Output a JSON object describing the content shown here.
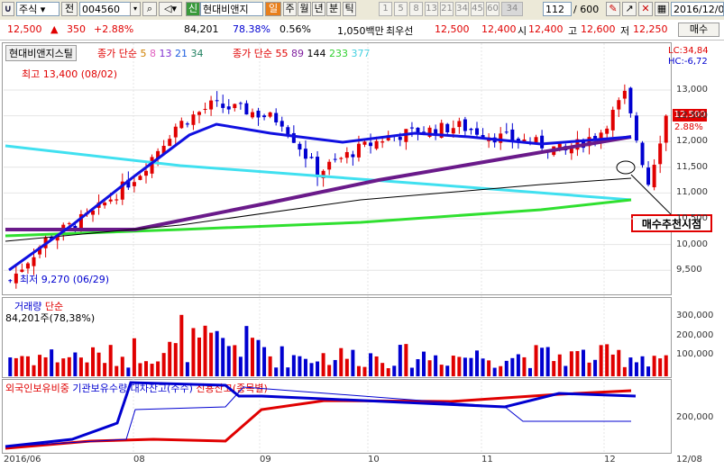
{
  "toolbar": {
    "market_type": "주식",
    "jeon_label": "전",
    "code": "004560",
    "sin_label": "신",
    "stock_name": "현대비앤지",
    "il_label": "일",
    "periods": [
      "주",
      "월",
      "년",
      "분",
      "틱"
    ],
    "minute_numbers": [
      "1",
      "5",
      "8",
      "13",
      "21",
      "34",
      "45",
      "60",
      "34"
    ],
    "count_value": "112",
    "total": "600",
    "date": "2016/12/0",
    "trade_button": "매수"
  },
  "quote": {
    "price": "12,500",
    "change": "350",
    "change_rate": "+2.88%",
    "volume": "84,201",
    "vol_rate": "78.38%",
    "ratio": "0.56%",
    "amount": "1,050백만",
    "best_sell_label": "최우선",
    "best_sell": "12,500",
    "best_buy": "12,400",
    "open_label": "시",
    "open": "12,400",
    "high_label": "고",
    "high": "12,600",
    "low_label": "저",
    "low": "12,250"
  },
  "price_panel": {
    "stock_label": "현대비앤지스틸",
    "ma_short_title": "종가 단순",
    "ma_short": [
      "5",
      "8",
      "13",
      "21",
      "34"
    ],
    "ma_long_title": "종가 단순",
    "ma_long": [
      "55",
      "89",
      "144",
      "233",
      "377"
    ],
    "lc": "LC:34,84",
    "hc": "HC:-6,72",
    "max_label": "최고 13,400 (08/02)",
    "min_label": "최저 9,270 (06/29)",
    "current_price": "12,500",
    "current_change": "2.88%",
    "buy_signal": "매수추천시점",
    "y_ticks": [
      "13,000",
      "12,500",
      "12,000",
      "11,500",
      "11,000",
      "10,500",
      "10,000",
      "9,500"
    ]
  },
  "volume_panel": {
    "title": "거래량",
    "subtitle": "단순",
    "info": "84,201주(78,38%)",
    "y_ticks": [
      "300,000",
      "200,000",
      "100,000"
    ]
  },
  "foreign_panel": {
    "legend": [
      "외국인보유비중",
      "기관보유수량",
      "대차잔고(주수)",
      "신용잔고(종목별)"
    ],
    "y_tick": "200,000"
  },
  "x_axis": [
    "2016/06",
    "08",
    "09",
    "10",
    "11",
    "12",
    "12/08"
  ],
  "colors": {
    "up": "#e00000",
    "down": "#0000d0",
    "ma_blue": "#1010e0",
    "ma_purple": "#6a1a8a",
    "ma_cyan": "#40e0f0",
    "ma_green": "#30e030"
  }
}
